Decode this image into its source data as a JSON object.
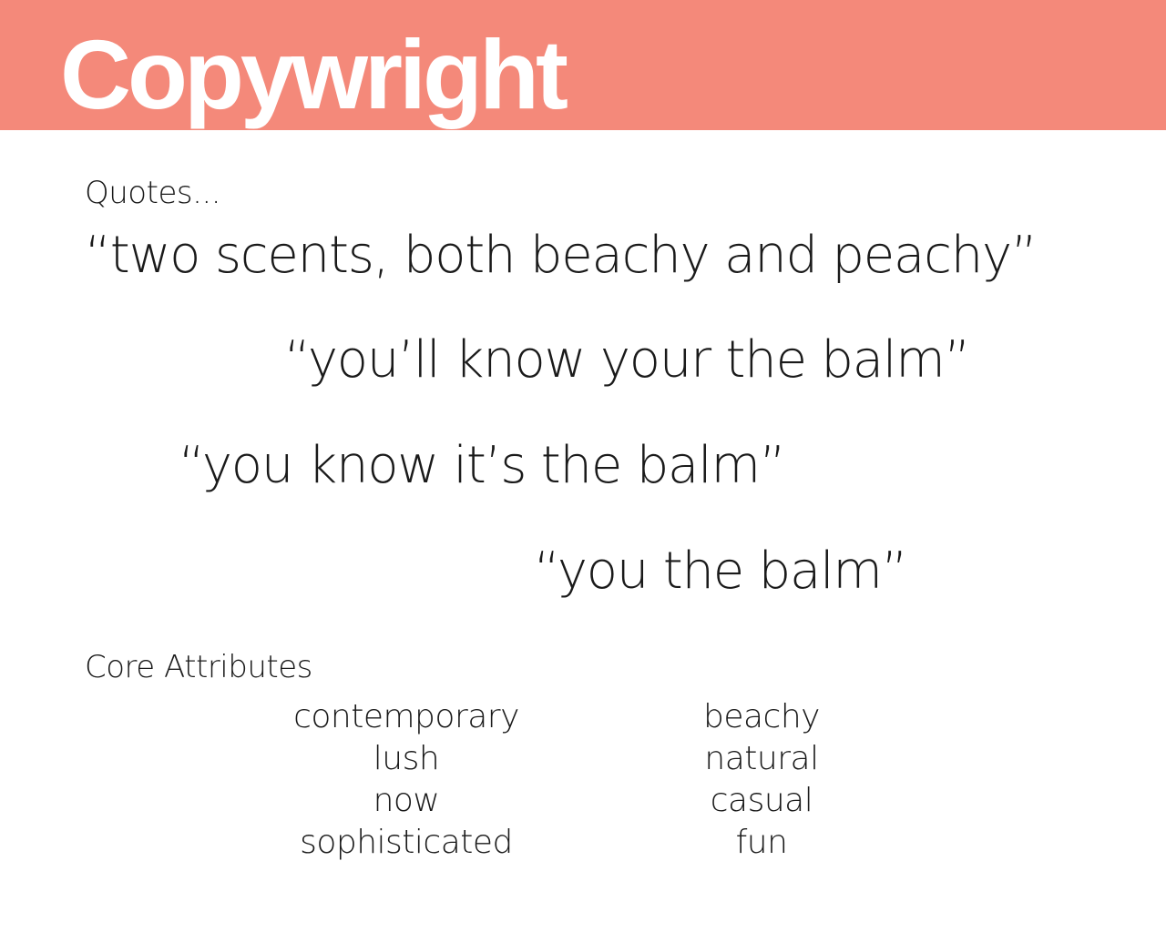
{
  "header": {
    "title": "Copywright",
    "band_color": "#f4897a",
    "title_color": "#ffffff"
  },
  "quotes": {
    "label": "Quotes...",
    "items": [
      "“two scents, both beachy and peachy”",
      "“you’ll know your the balm”",
      "“you know it’s the balm”",
      "“you the balm”"
    ]
  },
  "core_attributes": {
    "label": "Core Attributes",
    "left_column": [
      "contemporary",
      "lush",
      "now",
      "sophisticated"
    ],
    "right_column": [
      "beachy",
      "natural",
      "casual",
      "fun"
    ]
  }
}
